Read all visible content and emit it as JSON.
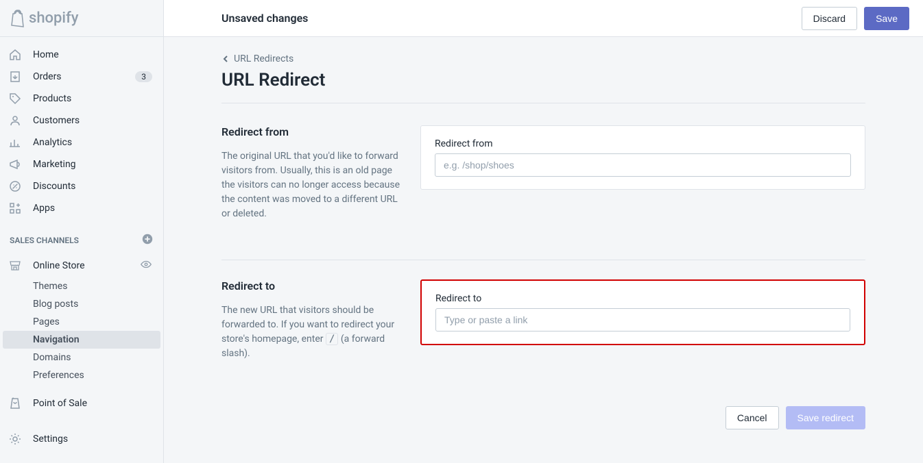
{
  "topbar": {
    "title": "Unsaved changes",
    "discard": "Discard",
    "save": "Save"
  },
  "brand": {
    "name": "shopify"
  },
  "sidebar": {
    "main": [
      {
        "label": "Home",
        "badge": null
      },
      {
        "label": "Orders",
        "badge": "3"
      },
      {
        "label": "Products",
        "badge": null
      },
      {
        "label": "Customers",
        "badge": null
      },
      {
        "label": "Analytics",
        "badge": null
      },
      {
        "label": "Marketing",
        "badge": null
      },
      {
        "label": "Discounts",
        "badge": null
      },
      {
        "label": "Apps",
        "badge": null
      }
    ],
    "channels_header": "SALES CHANNELS",
    "channels": [
      {
        "label": "Online Store",
        "sub": [
          {
            "label": "Themes"
          },
          {
            "label": "Blog posts"
          },
          {
            "label": "Pages"
          },
          {
            "label": "Navigation",
            "active": true
          },
          {
            "label": "Domains"
          },
          {
            "label": "Preferences"
          }
        ]
      },
      {
        "label": "Point of Sale"
      }
    ],
    "settings": "Settings"
  },
  "breadcrumb": {
    "label": "URL Redirects"
  },
  "page": {
    "title": "URL Redirect"
  },
  "redirect_from": {
    "heading": "Redirect from",
    "desc": "The original URL that you'd like to forward visitors from. Usually, this is an old page the visitors can no longer access because the content was moved to a different URL or deleted.",
    "label": "Redirect from",
    "placeholder": "e.g. /shop/shoes"
  },
  "redirect_to": {
    "heading": "Redirect to",
    "desc_part1": "The new URL that visitors should be forwarded to. If you want to redirect your store's homepage, enter ",
    "desc_code": "/",
    "desc_part2": " (a forward slash).",
    "label": "Redirect to",
    "placeholder": "Type or paste a link"
  },
  "footer": {
    "cancel": "Cancel",
    "save": "Save redirect"
  }
}
